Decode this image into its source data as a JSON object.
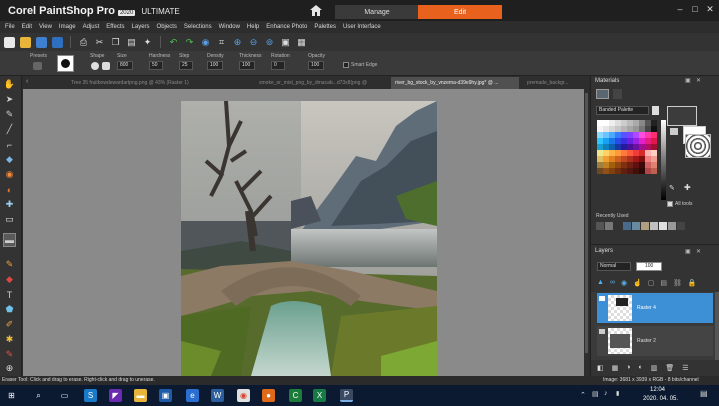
{
  "app": {
    "brand_main": "Corel PaintShop Pro",
    "brand_year": "2020",
    "brand_edition": "ULTIMATE",
    "tabs": {
      "manage": "Manage",
      "edit": "Edit"
    }
  },
  "menu": [
    "File",
    "Edit",
    "View",
    "Image",
    "Adjust",
    "Effects",
    "Layers",
    "Objects",
    "Selections",
    "Window",
    "Help",
    "Enhance Photo",
    "Palettes",
    "User Interface"
  ],
  "tool_options": {
    "presets": "Presets",
    "shape": "Shape",
    "size": "Size",
    "size_value": "800",
    "hardness": "Hardness",
    "hardness_value": "50",
    "step": "Step",
    "step_value": "25",
    "density": "Density",
    "density_value": "100",
    "thickness": "Thickness",
    "thickness_value": "100",
    "rotation": "Rotation",
    "rotation_value": "0",
    "opacity": "Opacity",
    "opacity_value": "100",
    "smart_edge": "Smart Edge"
  },
  "doc_tabs": [
    "Tree 35 fruitbowdewardartpng.png @ 43% (Raster 1)",
    "smoke_or_mist_png_by_dmacab...d73x8(png @",
    "river_bg_stock_by_vnzema-d39e9hy.jpg* @ ...",
    "premade_backgr..."
  ],
  "materials": {
    "title": "Materials",
    "palette_select": "Banded Palette",
    "all_tools": "All tools",
    "recently_used": "Recently Used"
  },
  "layers": {
    "title": "Layers",
    "blend_mode": "Normal",
    "opacity": "100",
    "items": [
      {
        "name": "Raster 4"
      },
      {
        "name": "Raster 2"
      }
    ]
  },
  "status": {
    "message": "Eraser Tool: Click and drag to erase. Right-click and drag to unerase.",
    "image_info": "Image: 3681 x 3939 x RGB - 8 bits/channel"
  },
  "taskbar": {
    "time": "12:04",
    "date": "2020. 04. 05."
  },
  "colors": {
    "accent": "#e8621d",
    "selected_layer": "#3d8fd6",
    "taskbar": "#0b1a30"
  }
}
